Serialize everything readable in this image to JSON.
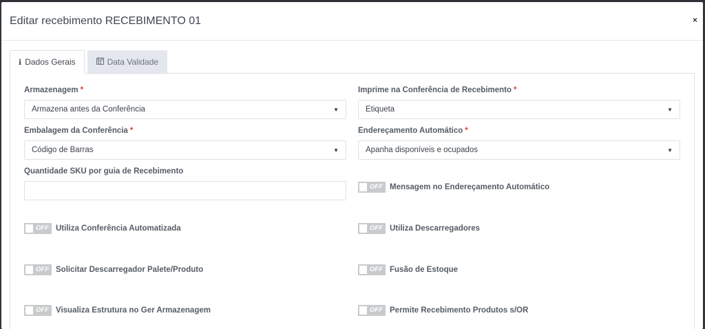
{
  "modal": {
    "title": "Editar recebimento RECEBIMENTO 01",
    "close": "×"
  },
  "tabs": [
    {
      "label": "Dados Gerais",
      "icon": "info-icon",
      "active": true
    },
    {
      "label": "Data Validade",
      "icon": "calendar-icon",
      "active": false
    }
  ],
  "form": {
    "armazenagem": {
      "label": "Armazenagem",
      "required": "*",
      "value": "Armazena antes da Conferência"
    },
    "imprime": {
      "label": "Imprime na Conferência de Recebimento",
      "required": "*",
      "value": "Etiqueta"
    },
    "embalagem": {
      "label": "Embalagem da Conferência",
      "required": "*",
      "value": "Código de Barras"
    },
    "enderecamento": {
      "label": "Endereçamento Automático",
      "required": "*",
      "value": "Apanha disponíveis e ocupados"
    },
    "quantidade": {
      "label": "Quantidade SKU por guia de Recebimento",
      "value": ""
    }
  },
  "toggles": {
    "off_text": "OFF",
    "mensagem": "Mensagem no Endereçamento Automático",
    "conferencia_auto": "Utiliza Conferência Automatizada",
    "descarregadores": "Utiliza Descarregadores",
    "solicitar": "Solicitar Descarregador Palete/Produto",
    "fusao": "Fusão de Estoque",
    "visualiza": "Visualiza Estrutura no Ger Armazenagem",
    "permite": "Permite Recebimento Produtos s/OR"
  }
}
